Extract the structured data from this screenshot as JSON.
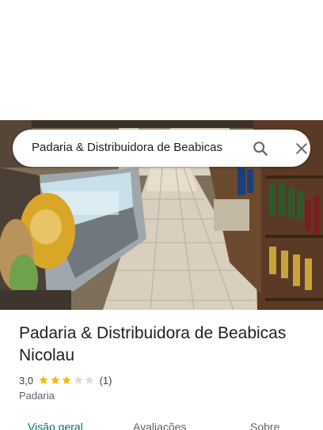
{
  "search": {
    "query": "Padaria & Distribuidora de Beabicas"
  },
  "place": {
    "name": "Padaria & Distribuidora de Beabicas Nicolau",
    "rating": "3,0",
    "rating_value": 3,
    "rating_max": 5,
    "review_count": "(1)",
    "category": "Padaria"
  },
  "tabs": [
    {
      "label": "Visão geral",
      "active": true
    },
    {
      "label": "Avaliações",
      "active": false
    },
    {
      "label": "Sobre",
      "active": false
    }
  ],
  "colors": {
    "star_filled": "#fbbc04",
    "star_empty": "#dadce0",
    "accent": "#00796b",
    "text": "#202124"
  },
  "icons": {
    "search": "search-icon",
    "close": "close-icon"
  }
}
